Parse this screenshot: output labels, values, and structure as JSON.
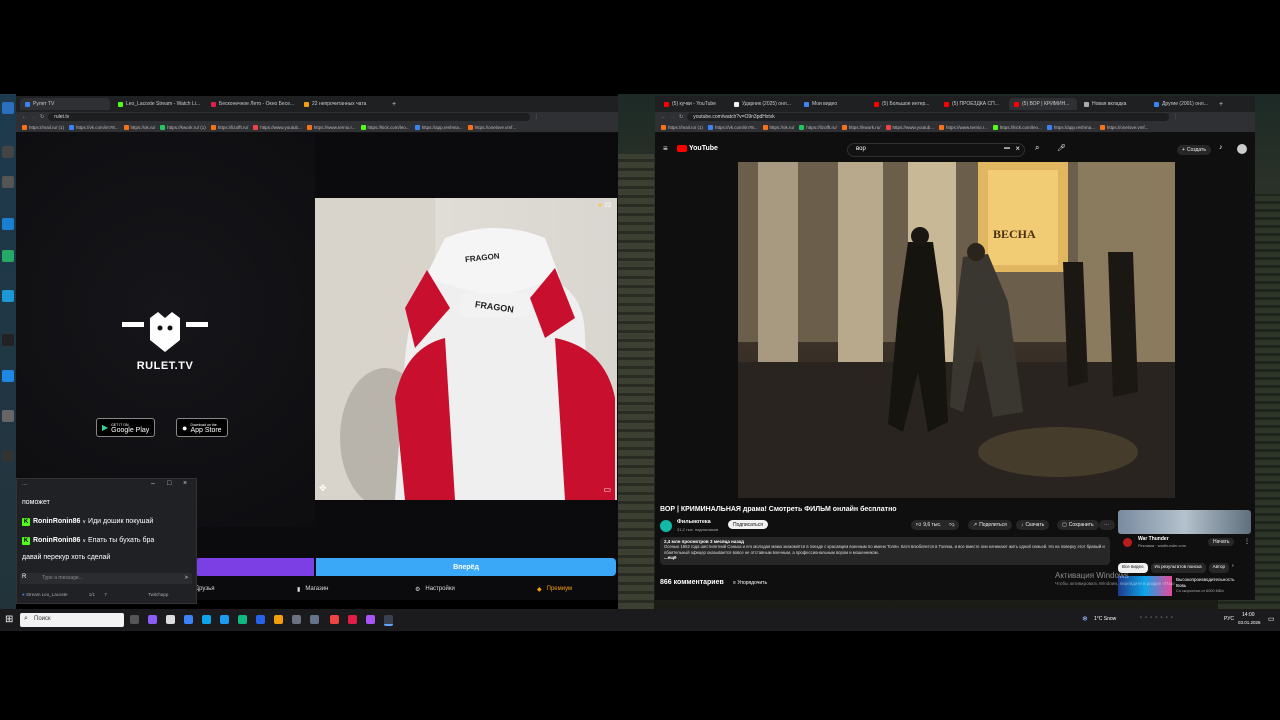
{
  "desktop": {
    "activation_title": "Активация Windows",
    "activation_text": "Чтобы активировать Windows, перейдите в раздел «Параметры»."
  },
  "left_browser": {
    "tabs": [
      {
        "label": "Рулет TV",
        "color": "#3b82f6"
      },
      {
        "label": "Leo_Lacoste Stream - Watch Li...",
        "color": "#53fc18"
      },
      {
        "label": "Бесконечное Лето - Окно Бесе...",
        "color": "#e11d48"
      },
      {
        "label": "22 непрочитанных чата",
        "color": "#f59e0b"
      }
    ],
    "url": "rulet.tv",
    "bookmarks": [
      "https://mail.ru/ (1)",
      "https://vk.com/im?8...",
      "https://ok.ru/",
      "https://kwork.ru/ (1)",
      "https://lizofft.ru/",
      "https://www.youtub...",
      "https://www.ternio.r...",
      "https://kick.com/leo...",
      "https://app.reshma...",
      "https://onelove.vmf..."
    ]
  },
  "rulet": {
    "logo_text": "RULET.TV",
    "google_play_small": "GET IT ON",
    "google_play": "Google Play",
    "app_store_small": "Download on the",
    "app_store": "App Store",
    "star_count": "23",
    "next_button": "Вперёд",
    "nav": {
      "friends": "Друзья",
      "shop": "Магазин",
      "settings": "Настройки",
      "premium": "Премиум"
    }
  },
  "chat": {
    "title": "...",
    "messages": [
      {
        "user": "",
        "text": "поможет"
      },
      {
        "user": "RoninRonin86",
        "text": "Иди дошик покушай"
      },
      {
        "user": "RoninRonin86",
        "text": "Епать ты бухать бра"
      },
      {
        "user": "",
        "text": "давай перекур хоть сделай"
      }
    ],
    "input_placeholder": "Type a message...",
    "footer_stream": "Stream Leo_Lacoste",
    "footer_count": "1/1",
    "footer_viewers": "7",
    "footer_platform": "Twitchapp"
  },
  "right_browser": {
    "tabs": [
      {
        "label": "(5) кучки - YouTube",
        "color": "#ff0000"
      },
      {
        "label": "Ударник (2025) онл...",
        "color": "#f1f1f1"
      },
      {
        "label": "Мои видео",
        "color": "#3b82f6"
      },
      {
        "label": "(5) Большое интер...",
        "color": "#ff0000"
      },
      {
        "label": "(5) ПРОЕЗДКА СП...",
        "color": "#ff0000"
      },
      {
        "label": "(5) ВОР | КРИМИН...",
        "color": "#ff0000"
      },
      {
        "label": "Новая вкладка",
        "color": "#aaaaaa"
      },
      {
        "label": "Другие (2001) онл...",
        "color": "#3b82f6"
      }
    ],
    "url": "youtube.com/watch?v=O9n3pdHxtvk",
    "bookmarks": [
      "https://mail.ru/ (1)",
      "https://vk.com/im?8...",
      "https://ok.ru/",
      "https://lizofft.ru/",
      "https://kwork.ru/",
      "https://www.youtub...",
      "https://www.ternio.r...",
      "https://kick.com/leo...",
      "https://app.reshma...",
      "https://onelove.vmf..."
    ]
  },
  "youtube": {
    "logo": "YouTube",
    "search_value": "вор",
    "create": "Создать",
    "movie_sign": "ВЕСНА",
    "video_title": "ВОР | КРИМИНАЛЬНАЯ драма! Смотреть ФИЛЬМ онлайн бесплатно",
    "channel": "Фильмотека",
    "subscribers": "31,2 тыс. подписчиков",
    "subscribe": "Подписаться",
    "likes": "9,6 тыс.",
    "share": "Поделиться",
    "download": "Скачать",
    "save": "Сохранить",
    "views": "2,4 млн просмотров  3 месяца назад",
    "description": "Осенью 1952 года шестилетний Санька и его молодая мама знакомятся в поезде с красавцем военным по имени Толян. Катя влюбляется в Толяна, и все вместе они начинают жить одной семьей. Но на поверку этот бравый и обаятельный офицер оказывается вовсе не отставным военным, а профессиональным вором и мошенником.",
    "more": "...ещё",
    "comments": "866 комментариев",
    "sort": "Упорядочить",
    "ad_title": "War Thunder",
    "ad_label": "Реклама · warthunder.com",
    "ad_button": "Начать",
    "filters": [
      "Все видео",
      "Из результатов поиска",
      "Автор"
    ],
    "side_video_line1": "Высокопроизводительность",
    "side_video_line2": "Вовь",
    "side_video_line3": "Со скоростью от 6000 МБ/с"
  },
  "taskbar": {
    "search_placeholder": "Поиск",
    "weather": "1°C  Snow",
    "lang": "РУС",
    "time": "14:00",
    "date": "03.01.2026"
  },
  "colors": {
    "rulet_purple": "#7b3fe4",
    "rulet_blue": "#3aa8f7",
    "kick_green": "#53fc18",
    "yt_red": "#ff0000"
  }
}
